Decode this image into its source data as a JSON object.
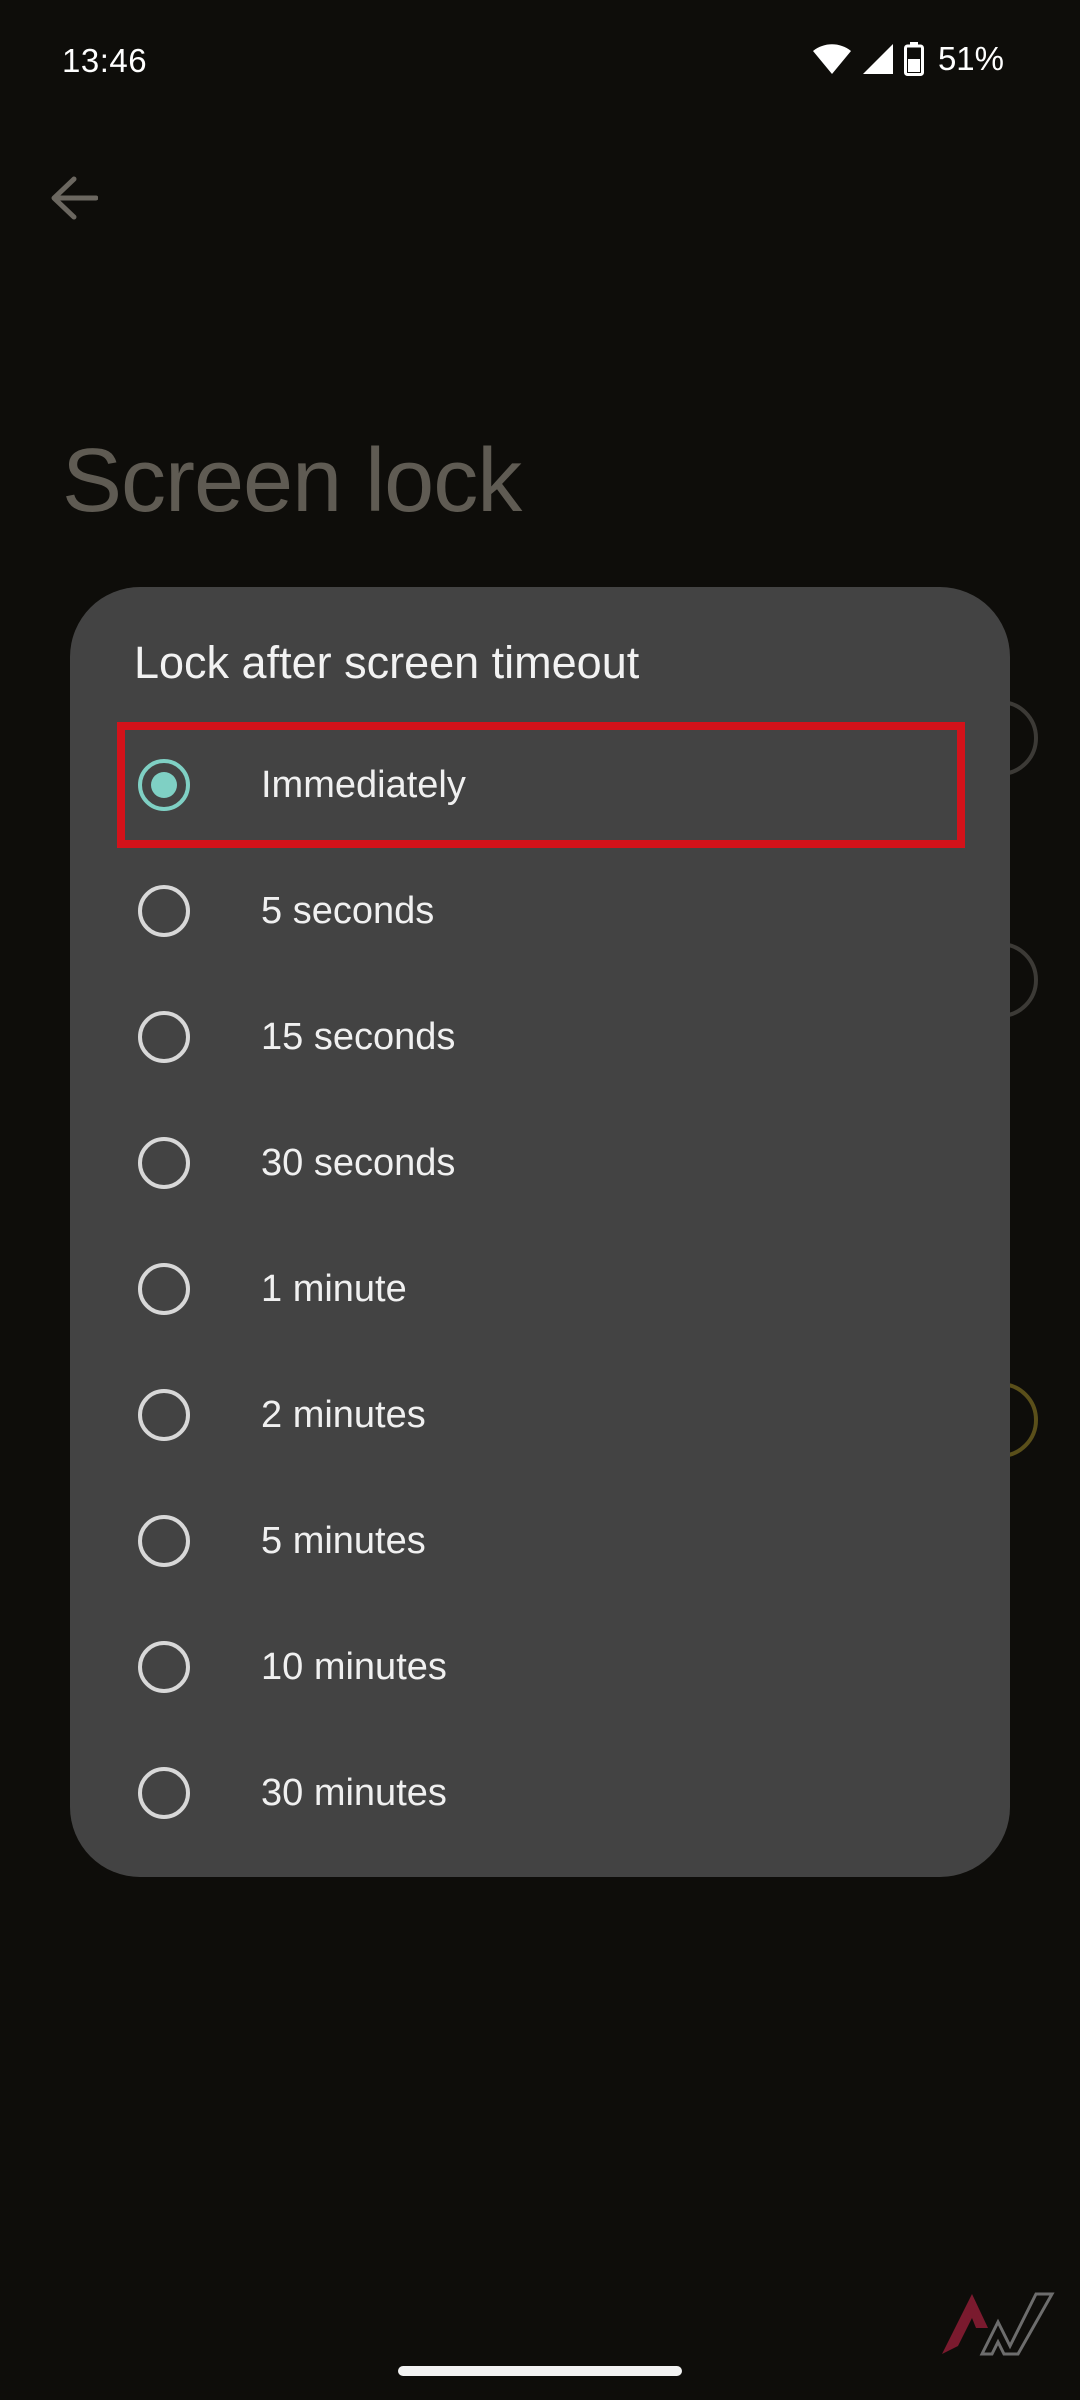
{
  "status_bar": {
    "time": "13:46",
    "battery": "51%",
    "icons": [
      "wifi-icon",
      "cell-signal-icon",
      "battery-icon"
    ]
  },
  "page": {
    "title": "Screen lock",
    "back_icon": "arrow-left-icon"
  },
  "dialog": {
    "title": "Lock after screen timeout",
    "options": [
      {
        "label": "Immediately",
        "selected": true,
        "highlighted": true
      },
      {
        "label": "5 seconds",
        "selected": false
      },
      {
        "label": "15 seconds",
        "selected": false
      },
      {
        "label": "30 seconds",
        "selected": false
      },
      {
        "label": "1 minute",
        "selected": false
      },
      {
        "label": "2 minutes",
        "selected": false
      },
      {
        "label": "5 minutes",
        "selected": false
      },
      {
        "label": "10 minutes",
        "selected": false
      },
      {
        "label": "30 minutes",
        "selected": false
      }
    ]
  },
  "colors": {
    "background": "#0e0d0a",
    "dialog": "#434343",
    "accent": "#7fd0c4",
    "highlight_box": "#d4121a"
  }
}
